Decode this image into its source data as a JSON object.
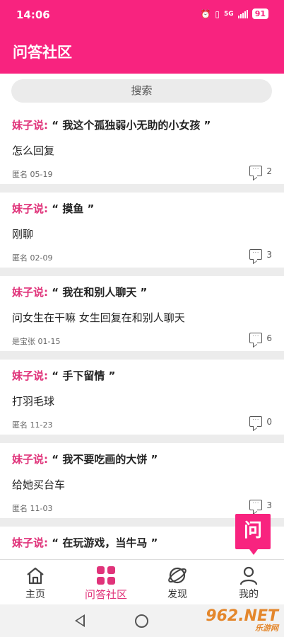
{
  "status": {
    "time": "14:06",
    "battery": "91",
    "network": "5G"
  },
  "header": {
    "title": "问答社区"
  },
  "search": {
    "label": "搜索"
  },
  "posts": [
    {
      "prefix": "妹子说:",
      "question": "“ 我这个孤独弱小无助的小女孩 ”",
      "answer": "怎么回复",
      "meta": "匿名 05-19",
      "comments": "2"
    },
    {
      "prefix": "妹子说:",
      "question": "“ 摸鱼 ”",
      "answer": "刚聊",
      "meta": "匿名 02-09",
      "comments": "3"
    },
    {
      "prefix": "妹子说:",
      "question": "“ 我在和别人聊天 ”",
      "answer": "问女生在干嘛 女生回复在和别人聊天",
      "meta": "是宝张 01-15",
      "comments": "6"
    },
    {
      "prefix": "妹子说:",
      "question": "“ 手下留情 ”",
      "answer": "打羽毛球",
      "meta": "匿名 11-23",
      "comments": "0"
    },
    {
      "prefix": "妹子说:",
      "question": "“ 我不要吃画的大饼 ”",
      "answer": "给她买台车",
      "meta": "匿名 11-03",
      "comments": "3"
    },
    {
      "prefix": "妹子说:",
      "question": "“ 在玩游戏，当牛马 ”",
      "answer": "",
      "meta": "",
      "comments": ""
    }
  ],
  "fab": {
    "label": "问"
  },
  "tabs": [
    {
      "label": "主页",
      "icon": "home-icon"
    },
    {
      "label": "问答社区",
      "icon": "grid-icon",
      "active": true
    },
    {
      "label": "发现",
      "icon": "planet-icon"
    },
    {
      "label": "我的",
      "icon": "user-icon"
    }
  ],
  "watermark": {
    "text": "962.NET",
    "sub": "乐游网"
  },
  "colors": {
    "accent": "#f8237f",
    "prefix": "#e0337a"
  }
}
